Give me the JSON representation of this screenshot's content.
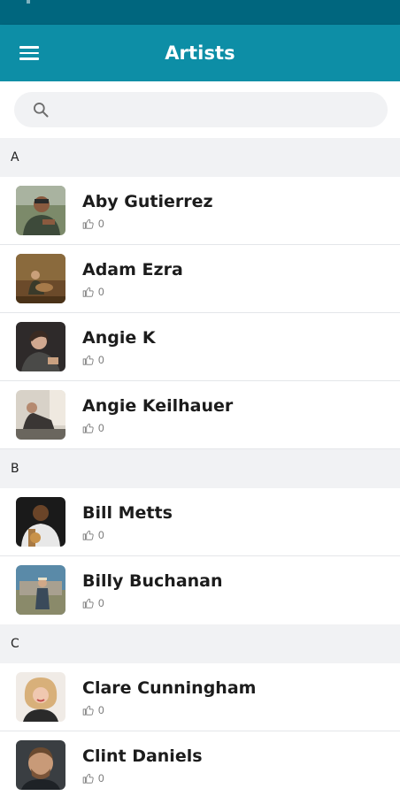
{
  "header": {
    "title": "Artists"
  },
  "search": {
    "placeholder": ""
  },
  "sections": [
    {
      "letter": "A",
      "artists": [
        {
          "name": "Aby Gutierrez",
          "likes": "0"
        },
        {
          "name": "Adam Ezra",
          "likes": "0"
        },
        {
          "name": "Angie K",
          "likes": "0"
        },
        {
          "name": "Angie Keilhauer",
          "likes": "0"
        }
      ]
    },
    {
      "letter": "B",
      "artists": [
        {
          "name": "Bill Metts",
          "likes": "0"
        },
        {
          "name": "Billy Buchanan",
          "likes": "0"
        }
      ]
    },
    {
      "letter": "C",
      "artists": [
        {
          "name": "Clare Cunningham",
          "likes": "0"
        },
        {
          "name": "Clint Daniels",
          "likes": "0"
        }
      ]
    }
  ],
  "colors": {
    "status_bar": "#00667e",
    "app_bar": "#0d8ea6",
    "section_bg": "#f1f2f4"
  },
  "icons": {
    "menu": "hamburger-menu-icon",
    "search": "magnifier-search-icon",
    "likes": "thumbs-up-icon"
  }
}
